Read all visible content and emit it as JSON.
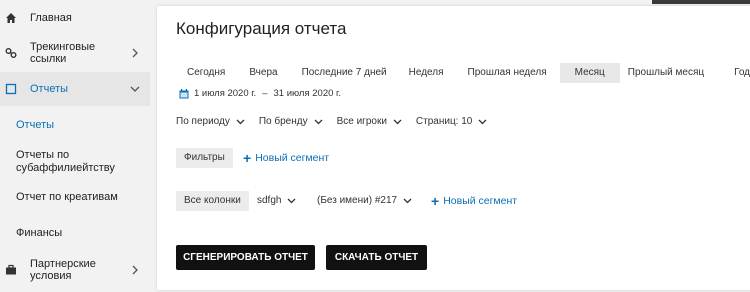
{
  "sidebar": {
    "items": [
      {
        "label": "Главная"
      },
      {
        "label": "Трекинговые\nссылки"
      },
      {
        "label": "Отчеты"
      },
      {
        "label": "Партнерские\nусловия"
      }
    ],
    "subitems": [
      {
        "label": "Отчеты"
      },
      {
        "label": "Отчеты по\nсубаффилиейтству"
      },
      {
        "label": "Отчет по креативам"
      },
      {
        "label": "Финансы"
      }
    ]
  },
  "main": {
    "title": "Конфигурация отчета",
    "periods": [
      "Сегодня",
      "Вчера",
      "Последние 7 дней",
      "Неделя",
      "Прошлая неделя",
      "Месяц",
      "Прошлый месяц",
      "Год"
    ],
    "active_period": "Месяц",
    "date_from": "1 июля 2020 г.",
    "date_sep": "–",
    "date_to": "31 июля 2020 г.",
    "filters": [
      "По периоду",
      "По бренду",
      "Все игроки",
      "Страниц: 10"
    ],
    "filters_chip": "Фильтры",
    "new_segment_1": "Новый сегмент",
    "columns_chip": "Все колонки",
    "column_sdfgh": "sdfgh",
    "column_noname": "(Без имени) #217",
    "new_segment_2": "Новый сегмент",
    "generate_button": "СГЕНЕРИРОВАТЬ ОТЧЕТ",
    "download_button": "СКАЧАТЬ ОТЧЕТ"
  },
  "colors": {
    "accent": "#0a6fb7",
    "button": "#111111"
  }
}
